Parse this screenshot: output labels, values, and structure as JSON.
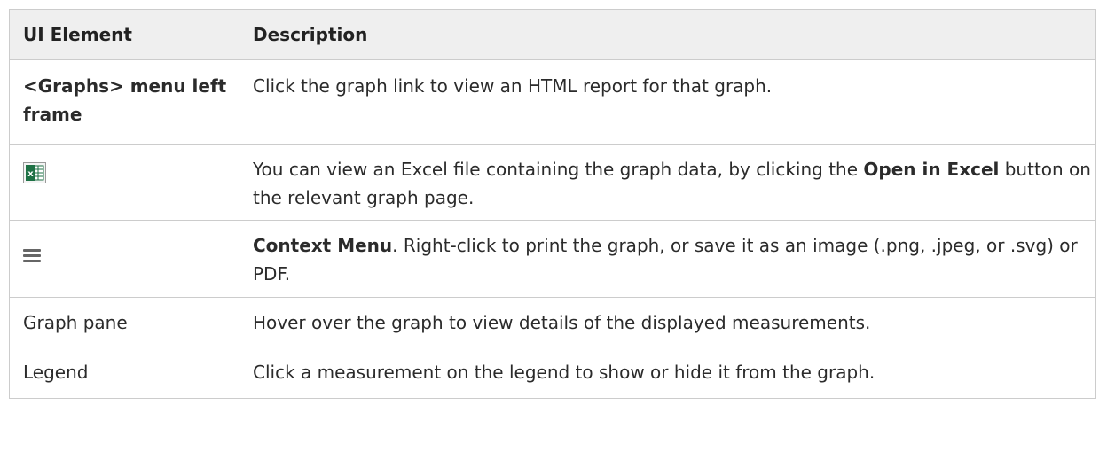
{
  "table": {
    "headers": [
      "UI Element",
      "Description"
    ],
    "rows": [
      {
        "element": "<Graphs> menu left frame",
        "description": "Click the graph link to view an HTML report for that graph."
      },
      {
        "element_icon": "excel-icon",
        "description_pre": "You can view an Excel file containing the graph data, by clicking the ",
        "description_bold": "Open in Excel",
        "description_post": " button on the relevant graph page."
      },
      {
        "element_icon": "hamburger-menu-icon",
        "description_bold": "Context Menu",
        "description_post": ". Right-click to print the graph, or save it as an image (.png, .jpeg, or .svg) or PDF."
      },
      {
        "element": "Graph pane",
        "description": "Hover over the graph to view details of the displayed measurements."
      },
      {
        "element": "Legend",
        "description": "Click a measurement on the legend to show or hide it from the graph."
      }
    ]
  },
  "colors": {
    "header_bg": "#efefef",
    "border": "#cccccc",
    "excel_green": "#1e7145"
  }
}
